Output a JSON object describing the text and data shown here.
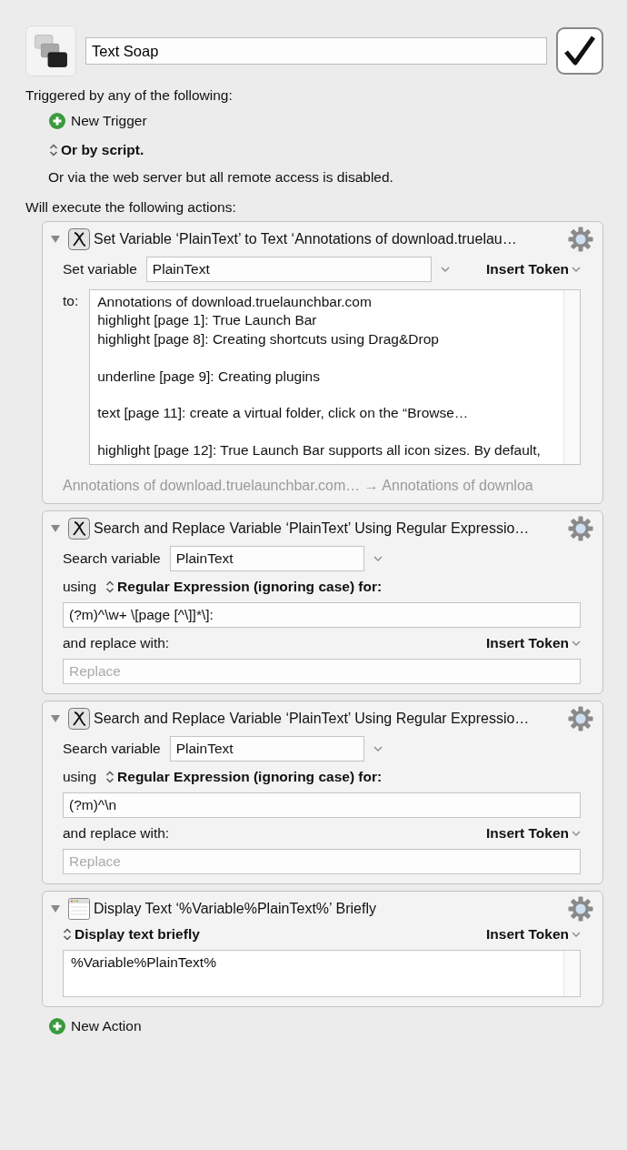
{
  "macro": {
    "name": "Text Soap",
    "enabled": true
  },
  "triggers": {
    "heading": "Triggered by any of the following:",
    "new_trigger": "New Trigger",
    "script_option": "Or by script.",
    "web_server_note": "Or via the web server but all remote access is disabled."
  },
  "actions_heading": "Will execute the following actions:",
  "actions": [
    {
      "kind": "set_variable",
      "title": "Set Variable ‘PlainText’ to Text ‘Annotations of download.truelau…",
      "variable_label": "Set variable",
      "variable": "PlainText",
      "insert_token": "Insert Token",
      "to_label": "to:",
      "text": "Annotations of download.truelaunchbar.com\nhighlight [page 1]: True Launch Bar\nhighlight [page 8]: Creating shortcuts using Drag&Drop\n\nunderline [page 9]: Creating plugins\n\ntext [page 11]: create a virtual folder, click on the “Browse…\n\nhighlight [page 12]: True Launch Bar supports all icon sizes. By default,",
      "summary": "Annotations of download.truelaunchbar.com… → Annotations of downloa"
    },
    {
      "kind": "search_replace",
      "title": "Search and Replace Variable ‘PlainText’ Using Regular Expressio…",
      "variable_label": "Search variable",
      "variable": "PlainText",
      "using_label": "using",
      "mode": "Regular Expression (ignoring case) for:",
      "pattern": "(?m)^\\w+ \\[page [^\\]]*\\]:",
      "replace_label": "and replace with:",
      "insert_token": "Insert Token",
      "replace_placeholder": "Replace"
    },
    {
      "kind": "search_replace",
      "title": "Search and Replace Variable ‘PlainText’ Using Regular Expressio…",
      "variable_label": "Search variable",
      "variable": "PlainText",
      "using_label": "using",
      "mode": "Regular Expression (ignoring case) for:",
      "pattern": "(?m)^\\n",
      "replace_label": "and replace with:",
      "insert_token": "Insert Token",
      "replace_placeholder": "Replace"
    },
    {
      "kind": "display_text",
      "title": "Display Text ‘%Variable%PlainText%’ Briefly",
      "mode": "Display text briefly",
      "insert_token": "Insert Token",
      "text": "%Variable%PlainText%"
    }
  ],
  "new_action": "New Action"
}
